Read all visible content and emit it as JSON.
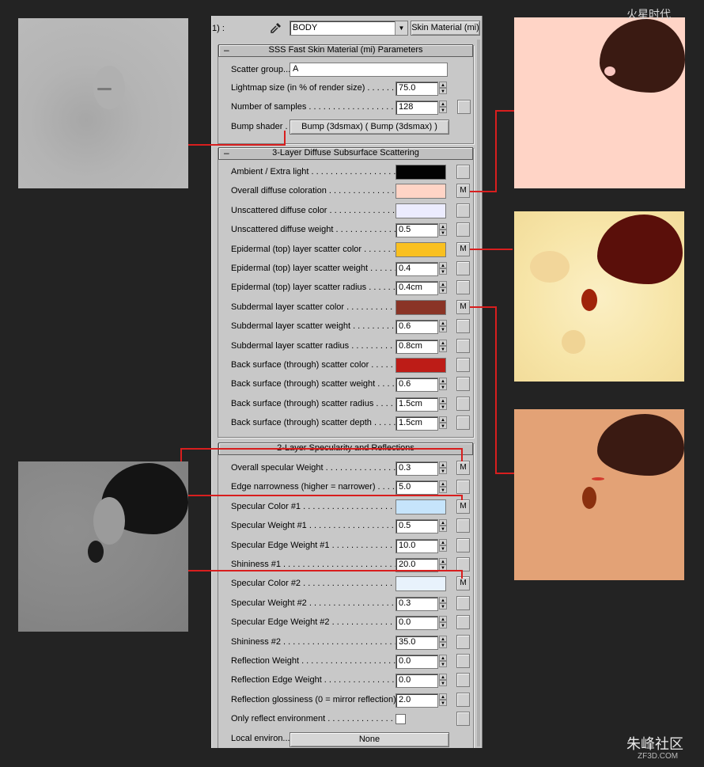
{
  "topbar": {
    "left_label": "1) :",
    "material_name": "BODY",
    "material_type": "Skin Material (mi)"
  },
  "rollouts": {
    "params_title": "SSS Fast Skin Material (mi) Parameters",
    "sss_title": "3-Layer Diffuse Subsurface Scattering",
    "spec_title": "2-Layer Specularity and Reflections"
  },
  "params": {
    "scatter_group_label": "Scatter group...",
    "scatter_group_value": "A",
    "lightmap_label": "Lightmap size (in % of render size) . . . . . . .",
    "lightmap_value": "75.0",
    "samples_label": "Number of samples . . . . . . . . . . . . . . . . . . .",
    "samples_value": "128",
    "bump_label": "Bump shader . .",
    "bump_value": "Bump (3dsmax)  ( Bump (3dsmax) )"
  },
  "sss": [
    {
      "label": "Ambient / Extra light . . . . . . . . . . . . . . . . . .",
      "kind": "color",
      "color": "#030303",
      "map": false
    },
    {
      "label": "Overall diffuse coloration . . . . . . . . . . . . . . .",
      "kind": "color",
      "color": "#ffd4c6",
      "map": true
    },
    {
      "label": "Unscattered diffuse color . . . . . . . . . . . . . . .",
      "kind": "color",
      "color": "#ececfe",
      "map": false
    },
    {
      "label": "Unscattered diffuse weight . . . . . . . . . . . . . .",
      "kind": "spin",
      "value": "0.5",
      "map": false
    },
    {
      "label": "Epidermal (top) layer scatter color . . . . . . . .",
      "kind": "color",
      "color": "#f9c020",
      "map": true
    },
    {
      "label": "Epidermal (top) layer scatter weight . . . . . . .",
      "kind": "spin",
      "value": "0.4",
      "map": false
    },
    {
      "label": "Epidermal (top) layer scatter radius . . . . . . .",
      "kind": "spin",
      "value": "0.4cm",
      "map": false
    },
    {
      "label": "Subdermal layer scatter color . . . . . . . . . . . .",
      "kind": "color",
      "color": "#8a3426",
      "map": true
    },
    {
      "label": "Subdermal layer scatter weight . . . . . . . . . . .",
      "kind": "spin",
      "value": "0.6",
      "map": false
    },
    {
      "label": "Subdermal layer scatter radius . . . . . . . . . . . .",
      "kind": "spin",
      "value": "0.8cm",
      "map": false
    },
    {
      "label": "Back surface (through) scatter color . . . . . . .",
      "kind": "color",
      "color": "#bd1c17",
      "map": false
    },
    {
      "label": "Back surface (through) scatter weight . . . . .",
      "kind": "spin",
      "value": "0.6",
      "map": false
    },
    {
      "label": "Back surface (through) scatter radius . . . . .",
      "kind": "spin",
      "value": "1.5cm",
      "map": false
    },
    {
      "label": "Back surface (through) scatter depth . . . . . .",
      "kind": "spin",
      "value": "1.5cm",
      "map": false
    }
  ],
  "spec": [
    {
      "label": "Overall specular Weight . . . . . . . . . . . . . . .",
      "kind": "spin",
      "value": "0.3",
      "map": true
    },
    {
      "label": "Edge narrowness (higher = narrower) . . . . .",
      "kind": "spin",
      "value": "5.0",
      "map": false
    },
    {
      "label": "Specular Color #1 . . . . . . . . . . . . . . . . . . . .",
      "kind": "color",
      "color": "#c6e4fb",
      "map": true
    },
    {
      "label": "Specular Weight #1 . . . . . . . . . . . . . . . . . .",
      "kind": "spin",
      "value": "0.5",
      "map": false
    },
    {
      "label": "Specular Edge Weight #1 . . . . . . . . . . . . . .",
      "kind": "spin",
      "value": "10.0",
      "map": false
    },
    {
      "label": "Shininess #1 . . . . . . . . . . . . . . . . . . . . . . . .",
      "kind": "spin",
      "value": "20.0",
      "map": false
    },
    {
      "label": "Specular Color #2 . . . . . . . . . . . . . . . . . . . .",
      "kind": "color",
      "color": "#e8f2fc",
      "map": true
    },
    {
      "label": "Specular Weight #2 . . . . . . . . . . . . . . . . . .",
      "kind": "spin",
      "value": "0.3",
      "map": false
    },
    {
      "label": "Specular Edge Weight #2 . . . . . . . . . . . . . .",
      "kind": "spin",
      "value": "0.0",
      "map": false
    },
    {
      "label": "Shininess #2 . . . . . . . . . . . . . . . . . . . . . . . .",
      "kind": "spin",
      "value": "35.0",
      "map": false
    },
    {
      "label": "Reflection Weight . . . . . . . . . . . . . . . . . . . .",
      "kind": "spin",
      "value": "0.0",
      "map": false
    },
    {
      "label": "Reflection Edge Weight . . . . . . . . . . . . . . . .",
      "kind": "spin",
      "value": "0.0",
      "map": false
    },
    {
      "label": "Reflection glossiness (0 = mirror reflection) .",
      "kind": "spin",
      "value": "2.0",
      "map": false
    },
    {
      "label": "Only reflect environment . . . . . . . . . . . . . . .",
      "kind": "check",
      "map": false
    },
    {
      "label": "Local environ...",
      "kind": "button",
      "value": "None",
      "map": false
    }
  ],
  "map_button_label": "M",
  "watermarks": {
    "top_right": "火星时代",
    "bottom_right": "朱峰社区",
    "bottom_right_sub": "ZF3D.COM"
  },
  "colors": {
    "line_red": "#d81e1e",
    "panel_bg": "#c8c8c8",
    "page_bg": "#232323"
  }
}
